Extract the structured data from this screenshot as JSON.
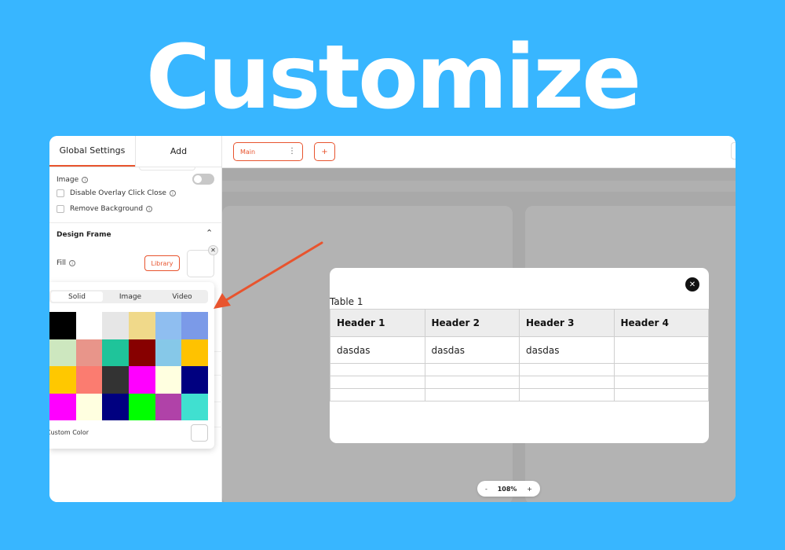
{
  "hero": {
    "title": "Customize"
  },
  "panel": {
    "tabs": [
      {
        "label": "Global Settings"
      },
      {
        "label": "Add"
      }
    ],
    "image_label": "Image",
    "disable_overlay_label": "Disable Overlay Click Close",
    "remove_background_label": "Remove Background",
    "design_frame_title": "Design Frame",
    "fill_label": "Fill",
    "library_label": "Library"
  },
  "color_picker": {
    "tabs": [
      {
        "label": "Solid"
      },
      {
        "label": "Image"
      },
      {
        "label": "Video"
      }
    ],
    "active_tab": "Solid",
    "swatches": [
      "#000000",
      "#ffffff",
      "#e6e6e6",
      "#f0d98a",
      "#8fbef0",
      "#7b9ae8",
      "#cde7bf",
      "#e8958a",
      "#1fc49a",
      "#870000",
      "#86c8e8",
      "#ffc200",
      "#ffc800",
      "#fb7c70",
      "#333333",
      "#ff00ff",
      "#ffffe0",
      "#000080",
      "#ff00ff",
      "#ffffe0",
      "#000080",
      "#00ff00",
      "#b042a8",
      "#40e0d0"
    ],
    "custom_label": "Custom Color"
  },
  "topbar": {
    "page_select": "Main",
    "add_label": "+"
  },
  "modal": {
    "caption": "Table 1",
    "headers": [
      "Header 1",
      "Header 2",
      "Header 3",
      "Header 4"
    ],
    "rows": [
      [
        "dasdas",
        "dasdas",
        "dasdas",
        ""
      ],
      [
        "",
        "",
        "",
        ""
      ],
      [
        "",
        "",
        "",
        ""
      ],
      [
        "",
        "",
        "",
        ""
      ]
    ]
  },
  "zoom": {
    "minus": "-",
    "value": "108%",
    "plus": "+"
  },
  "colors": {
    "accent": "#e8542e",
    "background": "#38b6ff",
    "arrow": "#e8542e"
  }
}
